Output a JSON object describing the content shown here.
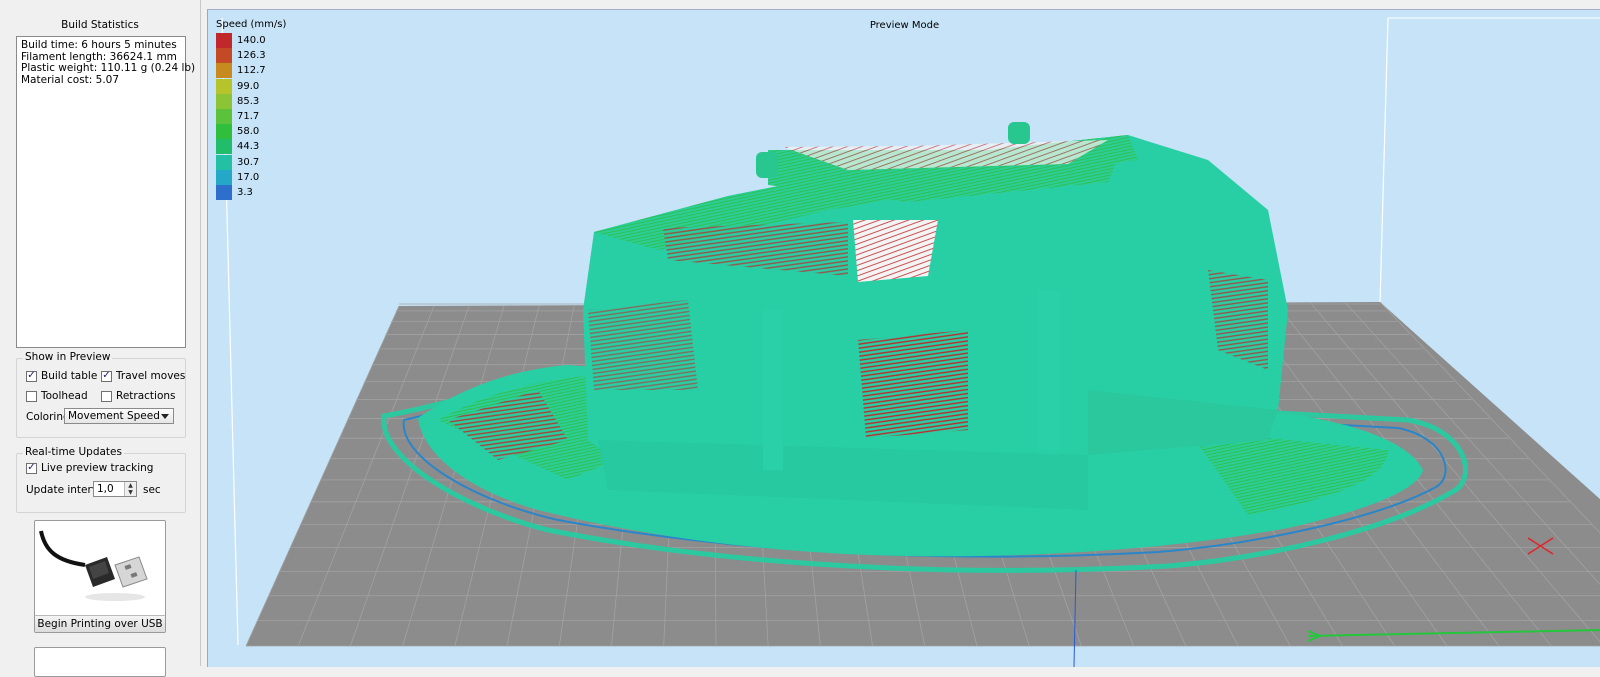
{
  "build_statistics": {
    "title": "Build Statistics",
    "lines": [
      "Build time: 6 hours 5 minutes",
      "Filament length: 36624.1 mm",
      "Plastic weight: 110.11 g (0.24 lb)",
      "Material cost: 5.07"
    ]
  },
  "show_in_preview": {
    "title": "Show in Preview",
    "build_table": {
      "label": "Build table",
      "checked": true
    },
    "travel_moves": {
      "label": "Travel moves",
      "checked": true
    },
    "toolhead": {
      "label": "Toolhead",
      "checked": false
    },
    "retractions": {
      "label": "Retractions",
      "checked": false
    },
    "coloring_label": "Coloring",
    "coloring_value": "Movement Speed"
  },
  "realtime_updates": {
    "title": "Real-time Updates",
    "live_preview": {
      "label": "Live preview tracking",
      "checked": true
    },
    "interval_label": "Update interval",
    "interval_value": "1,0",
    "interval_unit": "sec"
  },
  "usb": {
    "label": "Begin Printing over USB",
    "icon": "usb-cable-icon"
  },
  "viewport": {
    "title": "Preview Mode",
    "legend_title": "Speed (mm/s)",
    "legend": [
      {
        "value": "140.0",
        "color": "#c0282b"
      },
      {
        "value": "126.3",
        "color": "#c44a25"
      },
      {
        "value": "112.7",
        "color": "#c68a1f"
      },
      {
        "value": "99.0",
        "color": "#b4c42a"
      },
      {
        "value": "85.3",
        "color": "#8dc436"
      },
      {
        "value": "71.7",
        "color": "#5cc23c"
      },
      {
        "value": "58.0",
        "color": "#2fbf3d"
      },
      {
        "value": "44.3",
        "color": "#21bd6a"
      },
      {
        "value": "30.7",
        "color": "#24c0a6"
      },
      {
        "value": "17.0",
        "color": "#23a8c7"
      },
      {
        "value": "3.3",
        "color": "#2e6fcb"
      }
    ]
  },
  "colors": {
    "viewport_bg": "#c7e3f7",
    "bed": "#8c8c8c",
    "model_main": "#28cfa4",
    "model_green": "#2fc272",
    "fast_moves": "#c0282b"
  }
}
